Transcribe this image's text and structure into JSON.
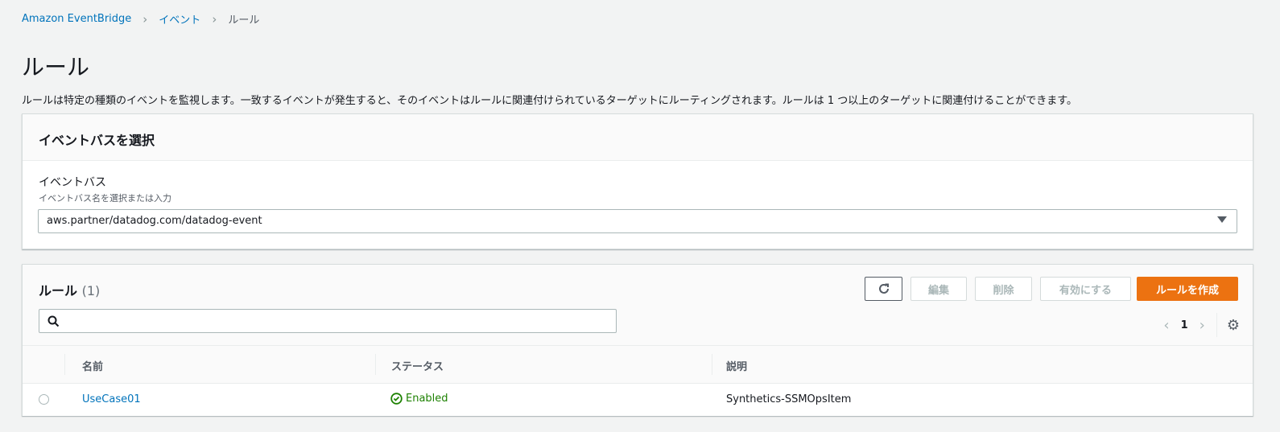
{
  "breadcrumb": [
    "Amazon EventBridge",
    "イベント",
    "ルール"
  ],
  "page": {
    "title": "ルール",
    "description": "ルールは特定の種類のイベントを監視します。一致するイベントが発生すると、そのイベントはルールに関連付けられているターゲットにルーティングされます。ルールは 1 つ以上のターゲットに関連付けることができます。"
  },
  "eventbus_panel": {
    "title": "イベントバスを選択",
    "label": "イベントバス",
    "hint": "イベントバス名を選択または入力",
    "value": "aws.partner/datadog.com/datadog-event"
  },
  "rules_panel": {
    "title": "ルール",
    "count": "(1)",
    "buttons": {
      "edit": "編集",
      "delete": "削除",
      "enable": "有効にする",
      "create": "ルールを作成"
    },
    "search_value": "",
    "page": "1",
    "columns": [
      "名前",
      "ステータス",
      "説明"
    ],
    "rows": [
      {
        "name": "UseCase01",
        "status": "Enabled",
        "description": "Synthetics-SSMOpsItem"
      }
    ]
  },
  "colors": {
    "accent": "#ec7211",
    "link": "#0073bb",
    "success": "#1d8102"
  }
}
